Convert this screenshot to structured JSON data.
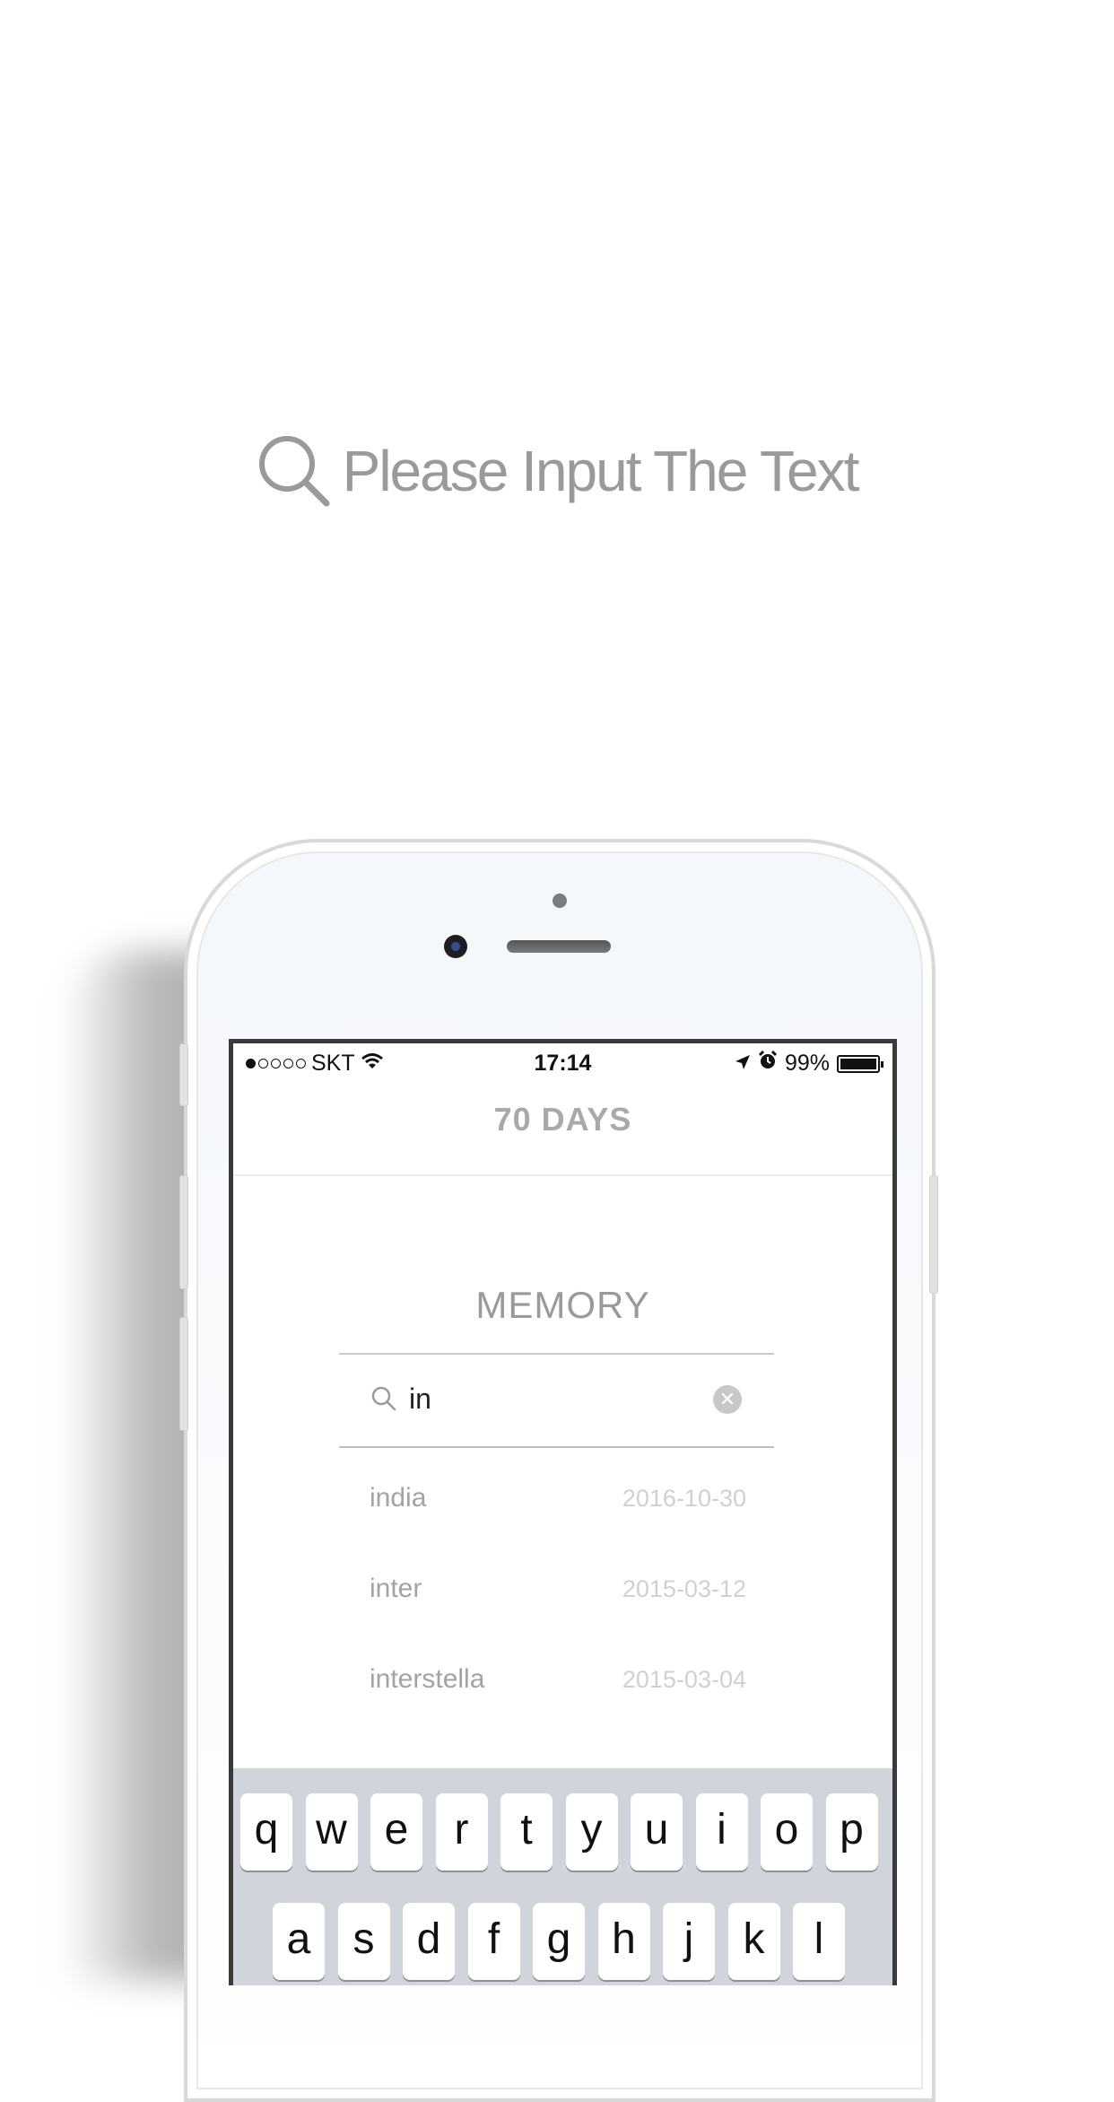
{
  "promo": {
    "headline": "Please Input The Text"
  },
  "status_bar": {
    "carrier": "SKT",
    "time": "17:14",
    "battery": "99%"
  },
  "nav": {
    "title": "70 DAYS"
  },
  "memory": {
    "section_title": "MEMORY",
    "search": {
      "value": "in"
    },
    "results": [
      {
        "name": "india",
        "date": "2016-10-30"
      },
      {
        "name": "inter",
        "date": "2015-03-12"
      },
      {
        "name": "interstella",
        "date": "2015-03-04"
      }
    ]
  },
  "keyboard": {
    "row1": [
      "q",
      "w",
      "e",
      "r",
      "t",
      "y",
      "u",
      "i",
      "o",
      "p"
    ],
    "row2": [
      "a",
      "s",
      "d",
      "f",
      "g",
      "h",
      "j",
      "k",
      "l"
    ]
  },
  "colors": {
    "headline_gray": "#9a9a9a",
    "title_gray": "#a9a9a9",
    "keyboard_bg": "#d1d4da"
  },
  "icons": {
    "headline": "search-icon",
    "search_field": "search-icon",
    "clear": "clear-icon",
    "wifi": "wifi-icon",
    "location": "location-arrow-icon",
    "alarm": "alarm-icon",
    "battery": "battery-icon"
  }
}
